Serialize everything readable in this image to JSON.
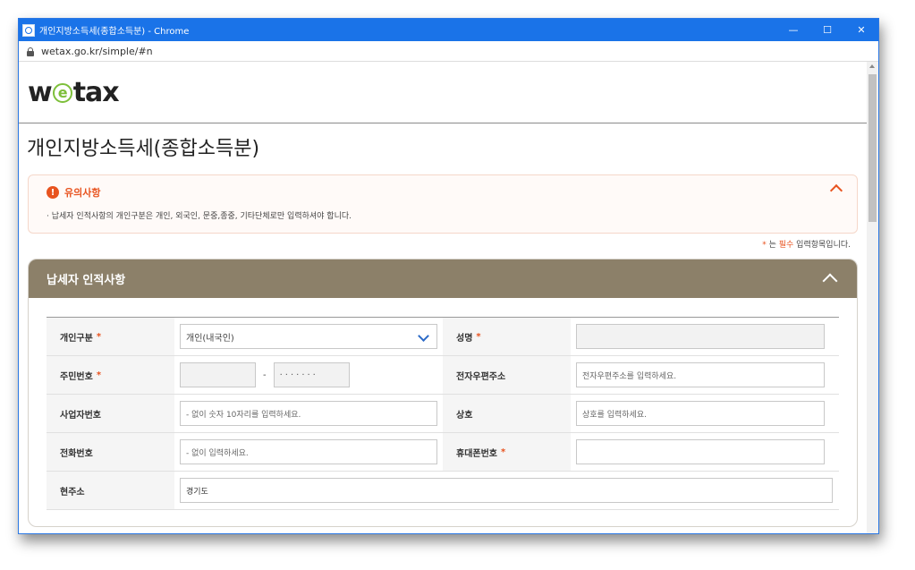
{
  "window": {
    "title": "개인지방소득세(종합소득분) - Chrome",
    "minimize": "—",
    "maximize": "☐",
    "close": "✕"
  },
  "address_bar": {
    "url": "wetax.go.kr/simple/#n"
  },
  "header": {
    "logo_pre": "w",
    "logo_e": "e",
    "logo_post": "tax"
  },
  "page": {
    "title": "개인지방소득세(종합소득분)"
  },
  "notice": {
    "heading": "유의사항",
    "icon": "!",
    "text": "· 납세자 인적사항의 개인구분은 개인, 외국인, 문중,종중, 기타단체로만 입력하셔야 합니다."
  },
  "required_note": {
    "star": "*",
    "pre": " 는 ",
    "emph": "필수",
    "post": " 입력항목입니다."
  },
  "section": {
    "title": "납세자 인적사항"
  },
  "form": {
    "req_mark": "*",
    "type_label": "개인구분",
    "type_value": "개인(내국인)",
    "name_label": "성명",
    "rrn_label": "주민번호",
    "rrn_dash": "-",
    "rrn_back": "·······",
    "epost_label": "전자우편주소",
    "epost_placeholder": "전자우편주소를 입력하세요.",
    "bizno_label": "사업자번호",
    "bizno_placeholder": "- 없이 숫자 10자리를 입력하세요.",
    "trade_label": "상호",
    "trade_placeholder": "상호를 입력하세요.",
    "phone_label": "전화번호",
    "phone_placeholder": "- 없이 입력하세요.",
    "mobile_label": "휴대폰번호",
    "address_label": "현주소",
    "address_value": "경기도"
  },
  "colors": {
    "titlebar": "#1a73e8",
    "section_header": "#8c8069",
    "accent_orange": "#e8531f",
    "logo_green": "#7dbf3a"
  }
}
